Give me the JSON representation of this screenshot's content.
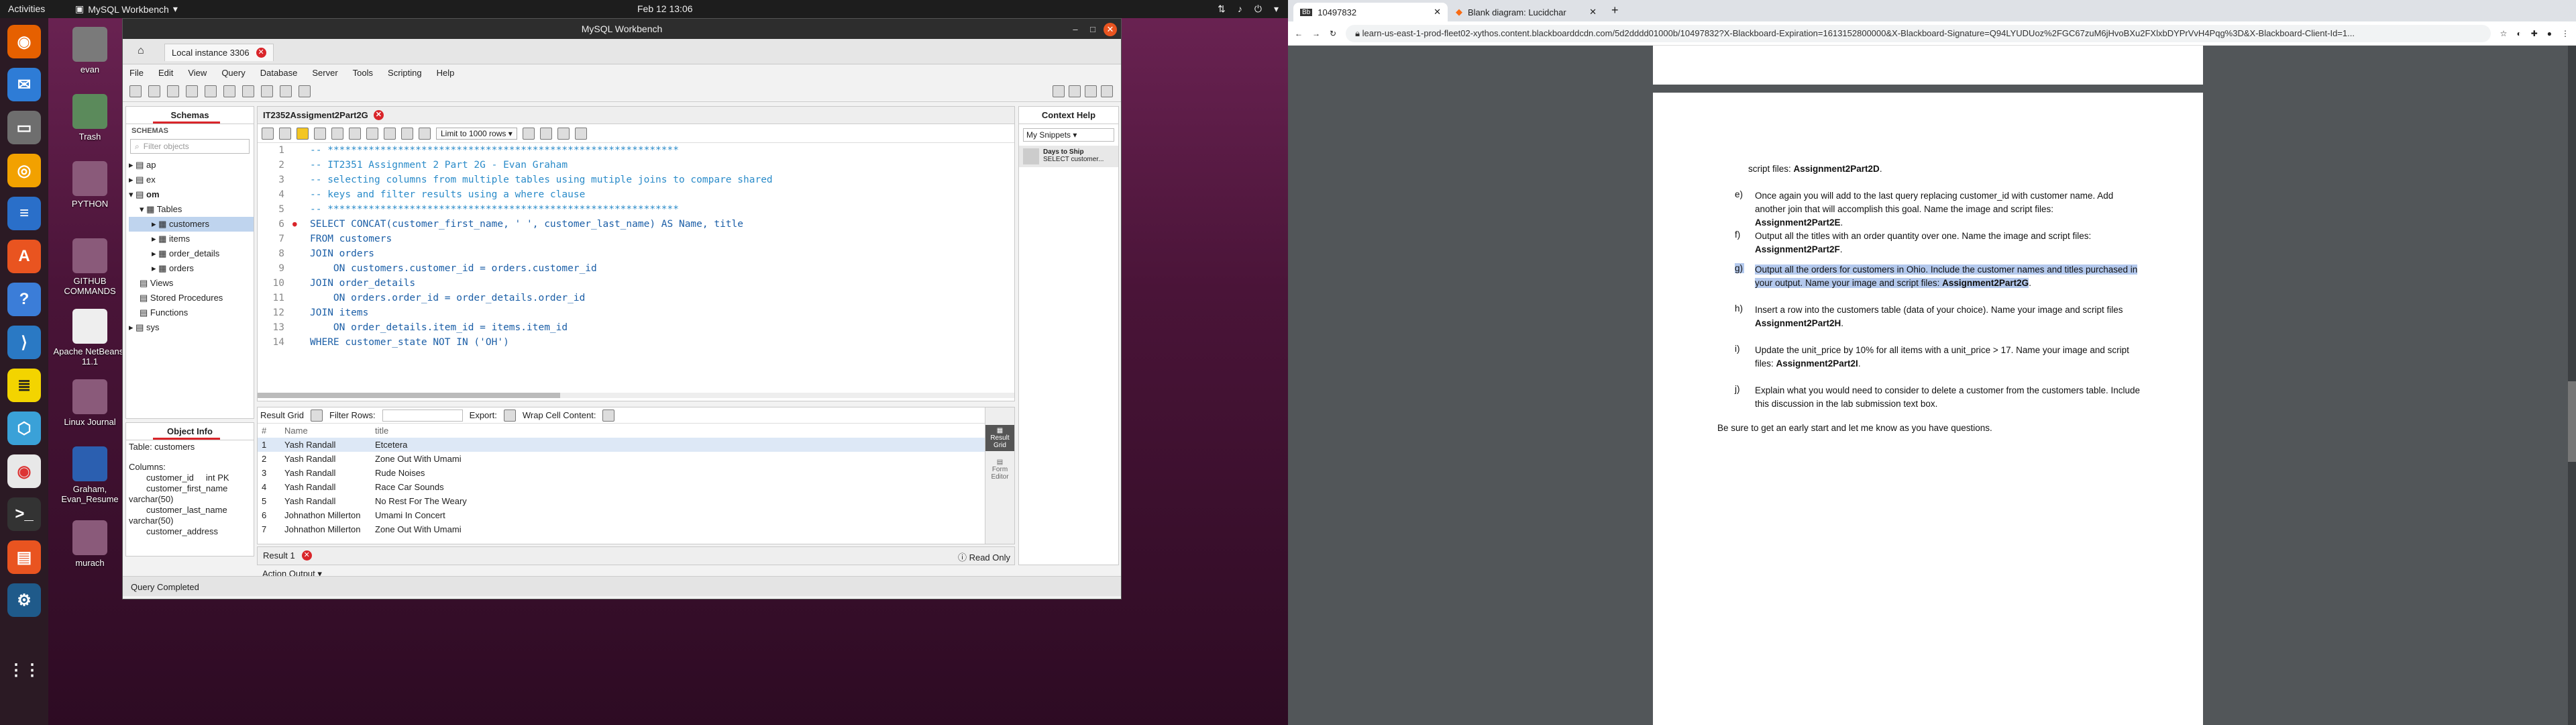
{
  "topbar": {
    "activities": "Activities",
    "app": "MySQL Workbench",
    "clock": "Feb 12  13:06"
  },
  "desktop_icons": [
    {
      "label": "evan"
    },
    {
      "label": "Trash"
    },
    {
      "label": "PYTHON"
    },
    {
      "label": "GITHUB COMMANDS"
    },
    {
      "label": "Apache NetBeans-11.1"
    },
    {
      "label": "Linux Journal"
    },
    {
      "label": "Graham, Evan_Resume"
    },
    {
      "label": "murach"
    }
  ],
  "workbench": {
    "title": "MySQL Workbench",
    "conn_tab": "Local instance 3306",
    "menu": [
      "File",
      "Edit",
      "View",
      "Query",
      "Database",
      "Server",
      "Tools",
      "Scripting",
      "Help"
    ],
    "navigator": {
      "tab": "Schemas",
      "header": "SCHEMAS",
      "filter_placeholder": "Filter objects",
      "tree": [
        "ap",
        "ex",
        "om",
        "Tables",
        "customers",
        "items",
        "order_details",
        "orders",
        "Views",
        "Stored Procedures",
        "Functions",
        "sys"
      ]
    },
    "info": {
      "tab": "Object Info",
      "table": "Table: customers",
      "columns_label": "Columns:",
      "cols": [
        "customer_id     int PK",
        "customer_first_name",
        "varchar(50)",
        "customer_last_name",
        "varchar(50)",
        "customer_address"
      ]
    },
    "query_tab": "IT2352Assigment2Part2G",
    "limit": "Limit to 1000 rows",
    "code": [
      "-- ************************************************************",
      "-- IT2351 Assignment 2 Part 2G - Evan Graham",
      "-- selecting columns from multiple tables using mutiple joins to compare shared",
      "-- keys and filter results using a where clause",
      "-- ************************************************************",
      "SELECT CONCAT(customer_first_name, ' ', customer_last_name) AS Name, title",
      "FROM customers",
      "JOIN orders",
      "    ON customers.customer_id = orders.customer_id",
      "JOIN order_details",
      "    ON orders.order_id = order_details.order_id",
      "JOIN items",
      "    ON order_details.item_id = items.item_id",
      "WHERE customer_state NOT IN ('OH')"
    ],
    "result": {
      "label": "Result Grid",
      "filter": "Filter Rows:",
      "export": "Export:",
      "wrap": "Wrap Cell Content:",
      "columns": [
        "#",
        "Name",
        "title"
      ],
      "rows": [
        [
          "1",
          "Yash Randall",
          "Etcetera"
        ],
        [
          "2",
          "Yash Randall",
          "Zone Out With Umami"
        ],
        [
          "3",
          "Yash Randall",
          "Rude Noises"
        ],
        [
          "4",
          "Yash Randall",
          "Race Car Sounds"
        ],
        [
          "5",
          "Yash Randall",
          "No Rest For The Weary"
        ],
        [
          "6",
          "Johnathon Millerton",
          "Umami In Concert"
        ],
        [
          "7",
          "Johnathon Millerton",
          "Zone Out With Umami"
        ]
      ],
      "side_grid": "Result Grid",
      "side_form": "Form Editor"
    },
    "result_tab": "Result 1",
    "read_only": "Read Only",
    "action_output": "Action Output",
    "context": {
      "tab": "Context Help",
      "snippets": "My Snippets",
      "snip_title": "Days to Ship",
      "snip_sub": "SELECT customer..."
    },
    "status": "Query Completed"
  },
  "browser": {
    "tabs": [
      "10497832",
      "Blank diagram: Lucidchar"
    ],
    "url": "learn-us-east-1-prod-fleet02-xythos.content.blackboarddcdn.com/5d2dddd01000b/10497832?X-Blackboard-Expiration=1613152800000&X-Blackboard-Signature=Q94LYUDUoz%2FGC67zuM6jHvoBXu2FXlxbDYPrVvH4Pqg%3D&X-Blackboard-Client-Id=1...",
    "doc": {
      "line0_pre": "script files: ",
      "line0_b": "Assignment2Part2D",
      "e_label": "e)",
      "e_text": "Once again you will add to the last query replacing customer_id with customer name.  Add another join that will accomplish this goal. Name the image and script files: ",
      "e_b": "Assignment2Part2E",
      "f_label": "f)",
      "f_text": "Output all the titles with an order quantity over one. Name the image and script files: ",
      "f_b": "Assignment2Part2F",
      "g_label": "g)",
      "g_text": "Output all the orders for customers in Ohio. Include the customer names and titles purchased in your output. Name your image and script files: ",
      "g_b": "Assignment2Part2G",
      "h_label": "h)",
      "h_text": "Insert a row into the customers table (data of your choice). Name your image and script files ",
      "h_b": "Assignment2Part2H",
      "i_label": "i)",
      "i_text": "Update the unit_price by 10% for all items with a unit_price > 17. Name your image and script files: ",
      "i_b": "Assignment2Part2I",
      "j_label": "j)",
      "j_text": "Explain what you would need to consider to delete a customer from the customers table. Include this discussion in the lab submission text box.",
      "closing": "Be sure to get an early start and let me know as you have questions."
    }
  }
}
